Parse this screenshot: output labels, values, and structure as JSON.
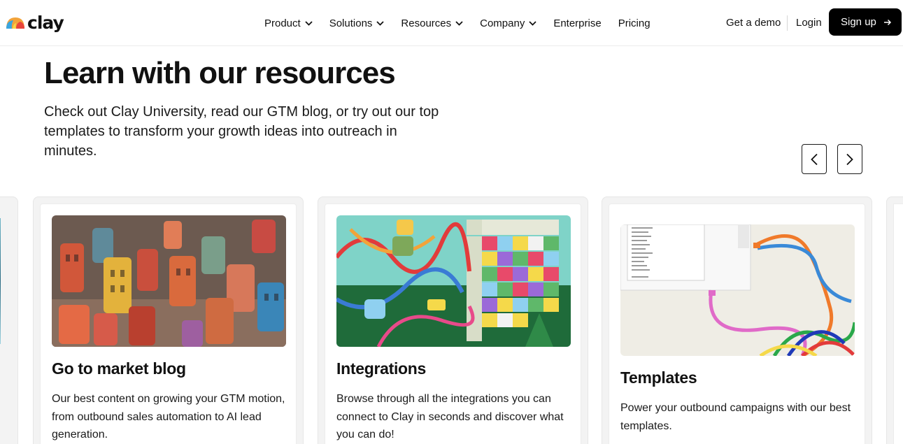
{
  "header": {
    "logo_text": "clay",
    "nav": [
      {
        "label": "Product",
        "has_dropdown": true
      },
      {
        "label": "Solutions",
        "has_dropdown": true
      },
      {
        "label": "Resources",
        "has_dropdown": true
      },
      {
        "label": "Company",
        "has_dropdown": true
      },
      {
        "label": "Enterprise",
        "has_dropdown": false
      },
      {
        "label": "Pricing",
        "has_dropdown": false
      }
    ],
    "get_demo": "Get a demo",
    "login": "Login",
    "signup": "Sign up"
  },
  "hero": {
    "title": "Learn with our resources",
    "subtitle": "Check out Clay University, read our GTM blog, or try out our top templates to transform your growth ideas into outreach in minutes."
  },
  "carousel": {
    "prev_icon": "chevron-left-icon",
    "next_icon": "chevron-right-icon"
  },
  "cards": [
    {
      "title": "Go to market blog",
      "description": "Our best content on growing your GTM motion, from outbound sales automation to AI lead generation.",
      "image": "clay-city-illustration"
    },
    {
      "title": "Integrations",
      "description": "Browse through all the integrations you can connect to Clay in seconds and discover what you can do!",
      "image": "clay-block-wall-illustration"
    },
    {
      "title": "Templates",
      "description": "Power your outbound campaigns with our best templates.",
      "image": "app-window-cables-illustration"
    }
  ],
  "colors": {
    "brand_black": "#000000",
    "card_bg": "#f3f3f3"
  }
}
